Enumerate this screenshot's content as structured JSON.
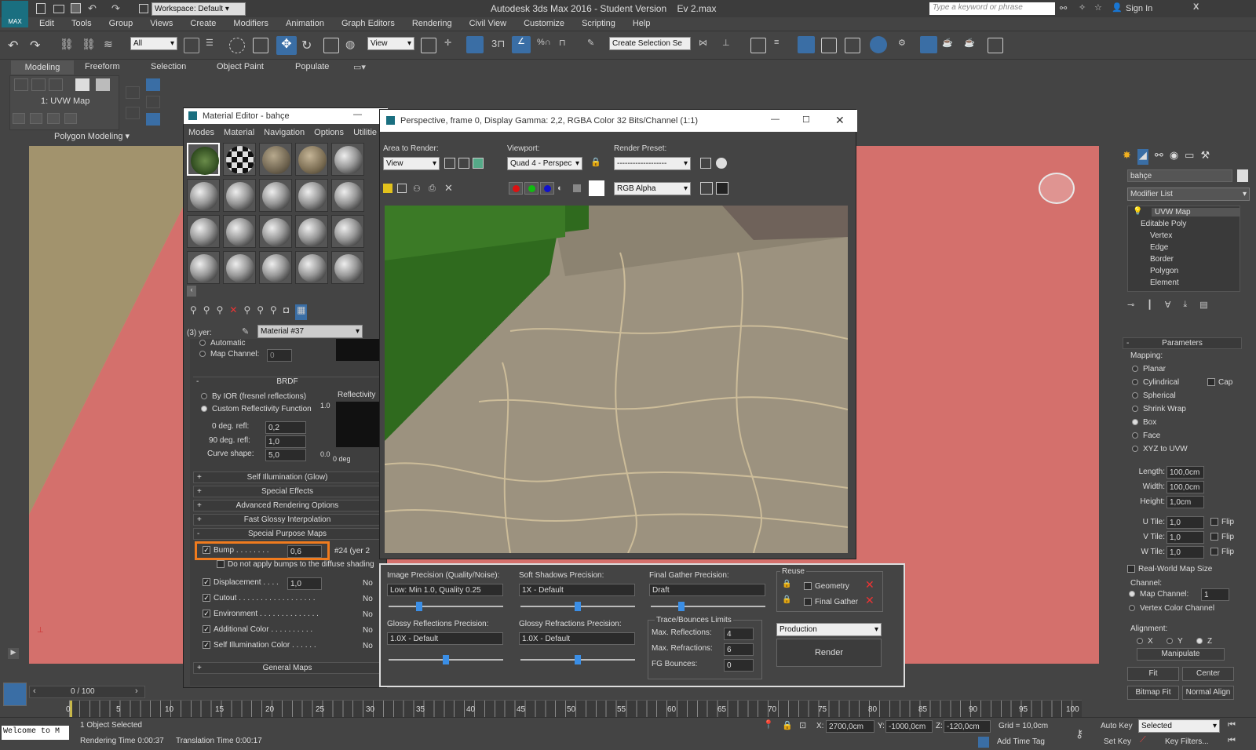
{
  "app": {
    "title": "Autodesk 3ds Max 2016 - Student Version    Ev 2.max",
    "logo": "MAX",
    "workspace": "Workspace: Default",
    "search_placeholder": "Type a keyword or phrase",
    "signin": "Sign In"
  },
  "menu": [
    "Edit",
    "Tools",
    "Group",
    "Views",
    "Create",
    "Modifiers",
    "Animation",
    "Graph Editors",
    "Rendering",
    "Civil View",
    "Customize",
    "Scripting",
    "Help"
  ],
  "toolbar": {
    "filter": "All",
    "ref_coord": "View",
    "selection_set": "Create Selection Se",
    "snap_3": "3",
    "snap_pct": "%"
  },
  "ribbon": {
    "tabs": [
      "Modeling",
      "Freeform",
      "Selection",
      "Object Paint",
      "Populate"
    ],
    "sub_label": "1: UVW Map",
    "polygon_modeling": "Polygon Modeling"
  },
  "material_editor": {
    "title": "Material Editor - bahçe",
    "menu": [
      "Modes",
      "Material",
      "Navigation",
      "Options",
      "Utilitie"
    ],
    "name_label": "(3) yer:",
    "material_name": "Material #37",
    "auto_label": "Automatic",
    "map_channel_label": "Map Channel:",
    "map_channel_value": "0",
    "brdf": {
      "header": "BRDF",
      "by_ior": "By IOR (fresnel reflections)",
      "custom": "Custom Reflectivity Function",
      "reflectivity": "Reflectivity",
      "r10": "1.0",
      "r00": "0.0",
      "deg0": "0 deg",
      "rows": [
        {
          "label": "0 deg. refl:",
          "value": "0,2"
        },
        {
          "label": "90 deg. refl:",
          "value": "1,0"
        },
        {
          "label": "Curve shape:",
          "value": "5,0"
        }
      ]
    },
    "rollouts": [
      "Self Illumination (Glow)",
      "Special Effects",
      "Advanced Rendering Options",
      "Fast Glossy Interpolation"
    ],
    "special_purpose": "Special Purpose Maps",
    "bump": {
      "label": "Bump . . . . . . . .",
      "value": "0,6",
      "map": "#24 (yer 2"
    },
    "bump_note": "Do not apply bumps to the diffuse shading",
    "maps": [
      {
        "label": "Displacement . . . .",
        "value": "1,0",
        "map": "No"
      },
      {
        "label": "Cutout . . . . . . . . . . . . . . . . . .",
        "value": "",
        "map": "No"
      },
      {
        "label": "Environment . . . . . . . . . . . . . .",
        "value": "",
        "map": "No"
      },
      {
        "label": "Additional Color . . . . . . . . . .",
        "value": "",
        "map": "No"
      },
      {
        "label": "Self Illumination Color . . . . . .",
        "value": "",
        "map": "No"
      }
    ],
    "general_maps": "General Maps"
  },
  "render_window": {
    "title": "Perspective, frame 0, Display Gamma: 2,2, RGBA Color 32 Bits/Channel (1:1)",
    "area_label": "Area to Render:",
    "area_value": "View",
    "viewport_label": "Viewport:",
    "viewport_value": "Quad 4 - Perspec",
    "preset_label": "Render Preset:",
    "preset_value": "-------------------",
    "channel_value": "RGB Alpha"
  },
  "render_settings": {
    "image_precision_label": "Image Precision (Quality/Noise):",
    "image_precision_value": "Low: Min 1.0, Quality 0.25",
    "soft_shadows_label": "Soft Shadows Precision:",
    "soft_shadows_value": "1X - Default",
    "final_gather_label": "Final Gather Precision:",
    "final_gather_value": "Draft",
    "glossy_refl_label": "Glossy Reflections Precision:",
    "glossy_refl_value": "1.0X - Default",
    "glossy_refr_label": "Glossy Refractions Precision:",
    "glossy_refr_value": "1.0X - Default",
    "trace_label": "Trace/Bounces Limits",
    "limits": [
      {
        "label": "Max. Reflections:",
        "value": "4"
      },
      {
        "label": "Max. Refractions:",
        "value": "6"
      },
      {
        "label": "FG Bounces:",
        "value": "0"
      }
    ],
    "reuse_label": "Reuse",
    "reuse_geometry": "Geometry",
    "reuse_fg": "Final Gather",
    "mode": "Production",
    "render_button": "Render",
    "slider_levels": {
      "image_precision": 0.25,
      "soft_shadows": 0.5,
      "final_gather": 0.25,
      "glossy_refl": 0.5,
      "glossy_refr": 0.5
    }
  },
  "command_panel": {
    "object_name": "bahçe",
    "modifier_list": "Modifier List",
    "stack": [
      {
        "label": "UVW Map",
        "level": 0
      },
      {
        "label": "Editable Poly",
        "level": 0
      },
      {
        "label": "Vertex",
        "level": 1
      },
      {
        "label": "Edge",
        "level": 1
      },
      {
        "label": "Border",
        "level": 1
      },
      {
        "label": "Polygon",
        "level": 1
      },
      {
        "label": "Element",
        "level": 1
      }
    ],
    "parameters": "Parameters",
    "mapping_label": "Mapping:",
    "mapping": [
      "Planar",
      "Cylindrical",
      "Spherical",
      "Shrink Wrap",
      "Box",
      "Face",
      "XYZ to UVW"
    ],
    "mapping_selected": "Box",
    "cap": "Cap",
    "dims": [
      {
        "label": "Length:",
        "value": "100,0cm"
      },
      {
        "label": "Width:",
        "value": "100,0cm"
      },
      {
        "label": "Height:",
        "value": "1,0cm"
      }
    ],
    "tiles": [
      {
        "label": "U Tile:",
        "value": "1,0"
      },
      {
        "label": "V Tile:",
        "value": "1,0"
      },
      {
        "label": "W Tile:",
        "value": "1,0"
      }
    ],
    "flip": "Flip",
    "real_world": "Real-World Map Size",
    "channel_label": "Channel:",
    "map_channel": "Map Channel:",
    "map_channel_value": "1",
    "vertex_color": "Vertex Color Channel",
    "alignment_label": "Alignment:",
    "axes": [
      "X",
      "Y",
      "Z"
    ],
    "manipulate": "Manipulate",
    "fit": "Fit",
    "center": "Center",
    "bitmap_fit": "Bitmap Fit",
    "normal_align": "Normal Align"
  },
  "timeline": {
    "frame": "0 / 100",
    "ticks": [
      "0",
      "5",
      "10",
      "15",
      "20",
      "25",
      "30",
      "35",
      "40",
      "45",
      "50",
      "55",
      "60",
      "65",
      "70",
      "75",
      "80",
      "85",
      "90",
      "95",
      "100"
    ]
  },
  "status": {
    "welcome": "Welcome to M",
    "selected": "1 Object Selected",
    "render_time": "Rendering Time  0:00:37",
    "translation_time": "Translation Time  0:00:17",
    "x_label": "X:",
    "x": "2700,0cm",
    "y_label": "Y:",
    "y": "-1000,0cm",
    "z_label": "Z:",
    "z": "-120,0cm",
    "grid": "Grid = 10,0cm",
    "add_time_tag": "Add Time Tag",
    "auto_key": "Auto Key",
    "set_key": "Set Key",
    "key_mode": "Selected",
    "key_filters": "Key Filters..."
  },
  "colors": {
    "accent": "#3a8ee6",
    "highlight": "#f07b1e",
    "viewport_floor": "#d4706c"
  }
}
